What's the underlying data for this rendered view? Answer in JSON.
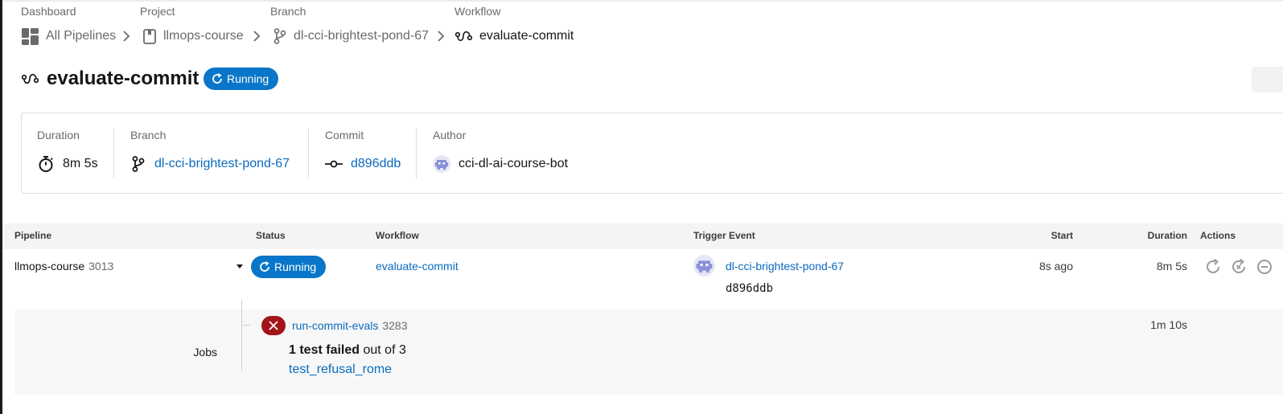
{
  "breadcrumb": {
    "dashboard": {
      "label": "Dashboard",
      "value": "All Pipelines"
    },
    "project": {
      "label": "Project",
      "value": "llmops-course"
    },
    "branch": {
      "label": "Branch",
      "value": "dl-cci-brightest-pond-67"
    },
    "workflow": {
      "label": "Workflow",
      "value": "evaluate-commit"
    }
  },
  "header": {
    "title": "evaluate-commit",
    "status": "Running"
  },
  "summary": {
    "duration": {
      "label": "Duration",
      "value": "8m 5s"
    },
    "branch": {
      "label": "Branch",
      "value": "dl-cci-brightest-pond-67"
    },
    "commit": {
      "label": "Commit",
      "value": "d896ddb"
    },
    "author": {
      "label": "Author",
      "value": "cci-dl-ai-course-bot"
    }
  },
  "table": {
    "headers": {
      "pipeline": "Pipeline",
      "status": "Status",
      "workflow": "Workflow",
      "trigger": "Trigger Event",
      "start": "Start",
      "duration": "Duration",
      "actions": "Actions"
    },
    "row": {
      "pipeline": "llmops-course",
      "pipeline_number": "3013",
      "status": "Running",
      "workflow": "evaluate-commit",
      "trigger_branch": "dl-cci-brightest-pond-67",
      "trigger_commit": "d896ddb",
      "start": "8s ago",
      "duration": "8m 5s"
    }
  },
  "jobs": {
    "label": "Jobs",
    "items": [
      {
        "name": "run-commit-evals",
        "number": "3283",
        "duration": "1m 10s",
        "failed_count": "1 test failed",
        "out_of": "out of 3",
        "failed_test": "test_refusal_rome"
      }
    ]
  },
  "colors": {
    "accent": "#0a76c9",
    "link": "#0a6bbf",
    "failed": "#a3141b",
    "avatar": "#8a8fd6"
  }
}
